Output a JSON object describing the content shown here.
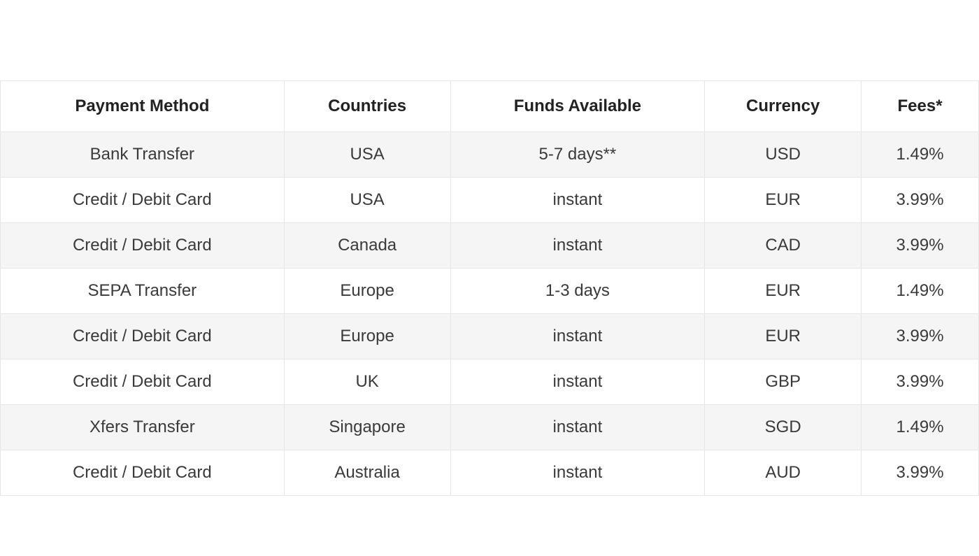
{
  "table": {
    "headers": {
      "payment_method": "Payment Method",
      "countries": "Countries",
      "funds_available": "Funds Available",
      "currency": "Currency",
      "fees": "Fees*"
    },
    "rows": [
      {
        "payment_method": "Bank Transfer",
        "countries": "USA",
        "funds_available": "5-7 days**",
        "currency": "USD",
        "fees": "1.49%"
      },
      {
        "payment_method": "Credit / Debit Card",
        "countries": "USA",
        "funds_available": "instant",
        "currency": "EUR",
        "fees": "3.99%"
      },
      {
        "payment_method": "Credit / Debit Card",
        "countries": "Canada",
        "funds_available": "instant",
        "currency": "CAD",
        "fees": "3.99%"
      },
      {
        "payment_method": "SEPA Transfer",
        "countries": "Europe",
        "funds_available": "1-3 days",
        "currency": "EUR",
        "fees": "1.49%"
      },
      {
        "payment_method": "Credit / Debit Card",
        "countries": "Europe",
        "funds_available": "instant",
        "currency": "EUR",
        "fees": "3.99%"
      },
      {
        "payment_method": "Credit / Debit Card",
        "countries": "UK",
        "funds_available": "instant",
        "currency": "GBP",
        "fees": "3.99%"
      },
      {
        "payment_method": "Xfers Transfer",
        "countries": "Singapore",
        "funds_available": "instant",
        "currency": "SGD",
        "fees": "1.49%"
      },
      {
        "payment_method": "Credit / Debit Card",
        "countries": "Australia",
        "funds_available": "instant",
        "currency": "AUD",
        "fees": "3.99%"
      }
    ]
  }
}
